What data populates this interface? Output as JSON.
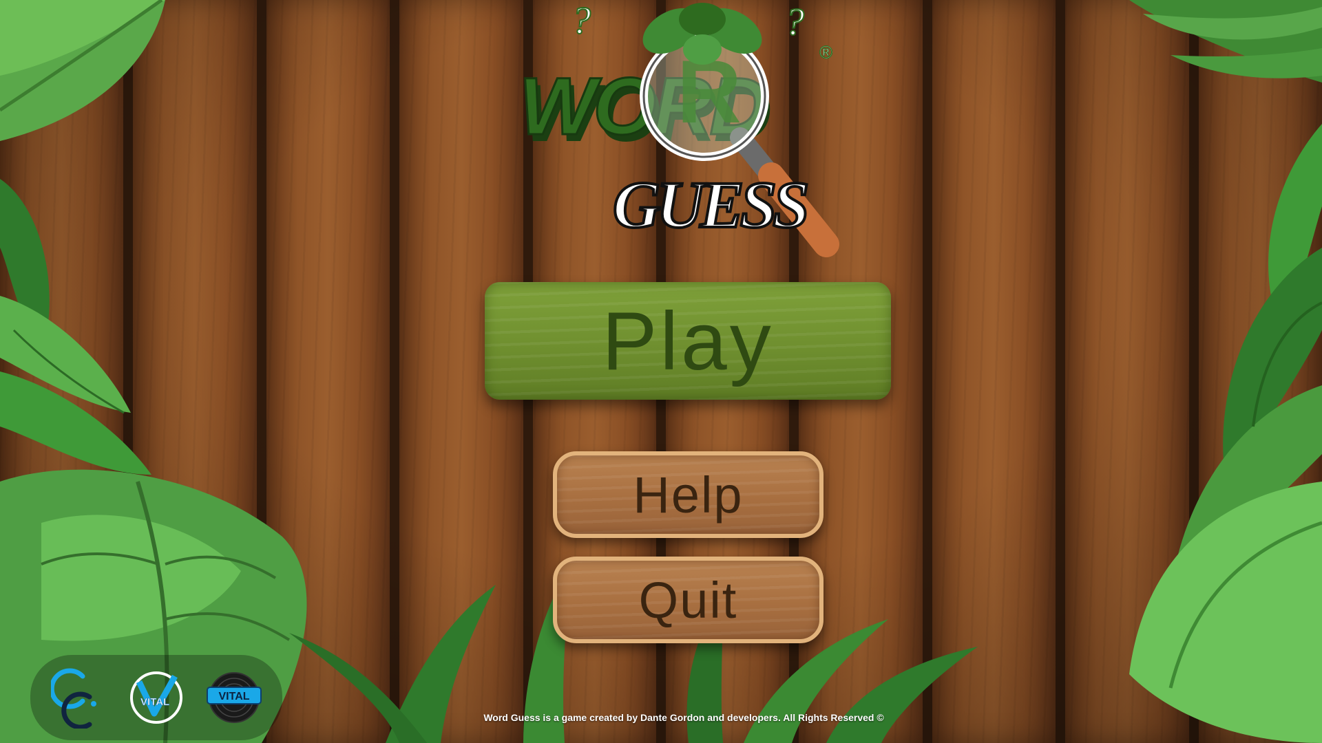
{
  "logo": {
    "title_top": "WORD",
    "title_bottom": "GUESS",
    "registered_mark": "®",
    "question_mark": "?"
  },
  "menu": {
    "play_label": "Play",
    "help_label": "Help",
    "quit_label": "Quit"
  },
  "sponsors": {
    "items": [
      {
        "icon": "cc-logo-icon"
      },
      {
        "icon": "vital-v-logo-icon",
        "text": "VITAL"
      },
      {
        "icon": "vital-records-logo-icon",
        "text": "VITAL"
      }
    ]
  },
  "footer": {
    "text": "Word Guess is a game created by Dante Gordon and developers. All Rights Reserved ©"
  },
  "colors": {
    "play_green": "#6f8f2f",
    "play_text": "#2f4a12",
    "wood_button": "#a86f40",
    "wood_border": "#e2b37c",
    "wood_text": "#3a2410",
    "logo_green": "#2e6b1f",
    "handle_orange": "#c8703a"
  }
}
